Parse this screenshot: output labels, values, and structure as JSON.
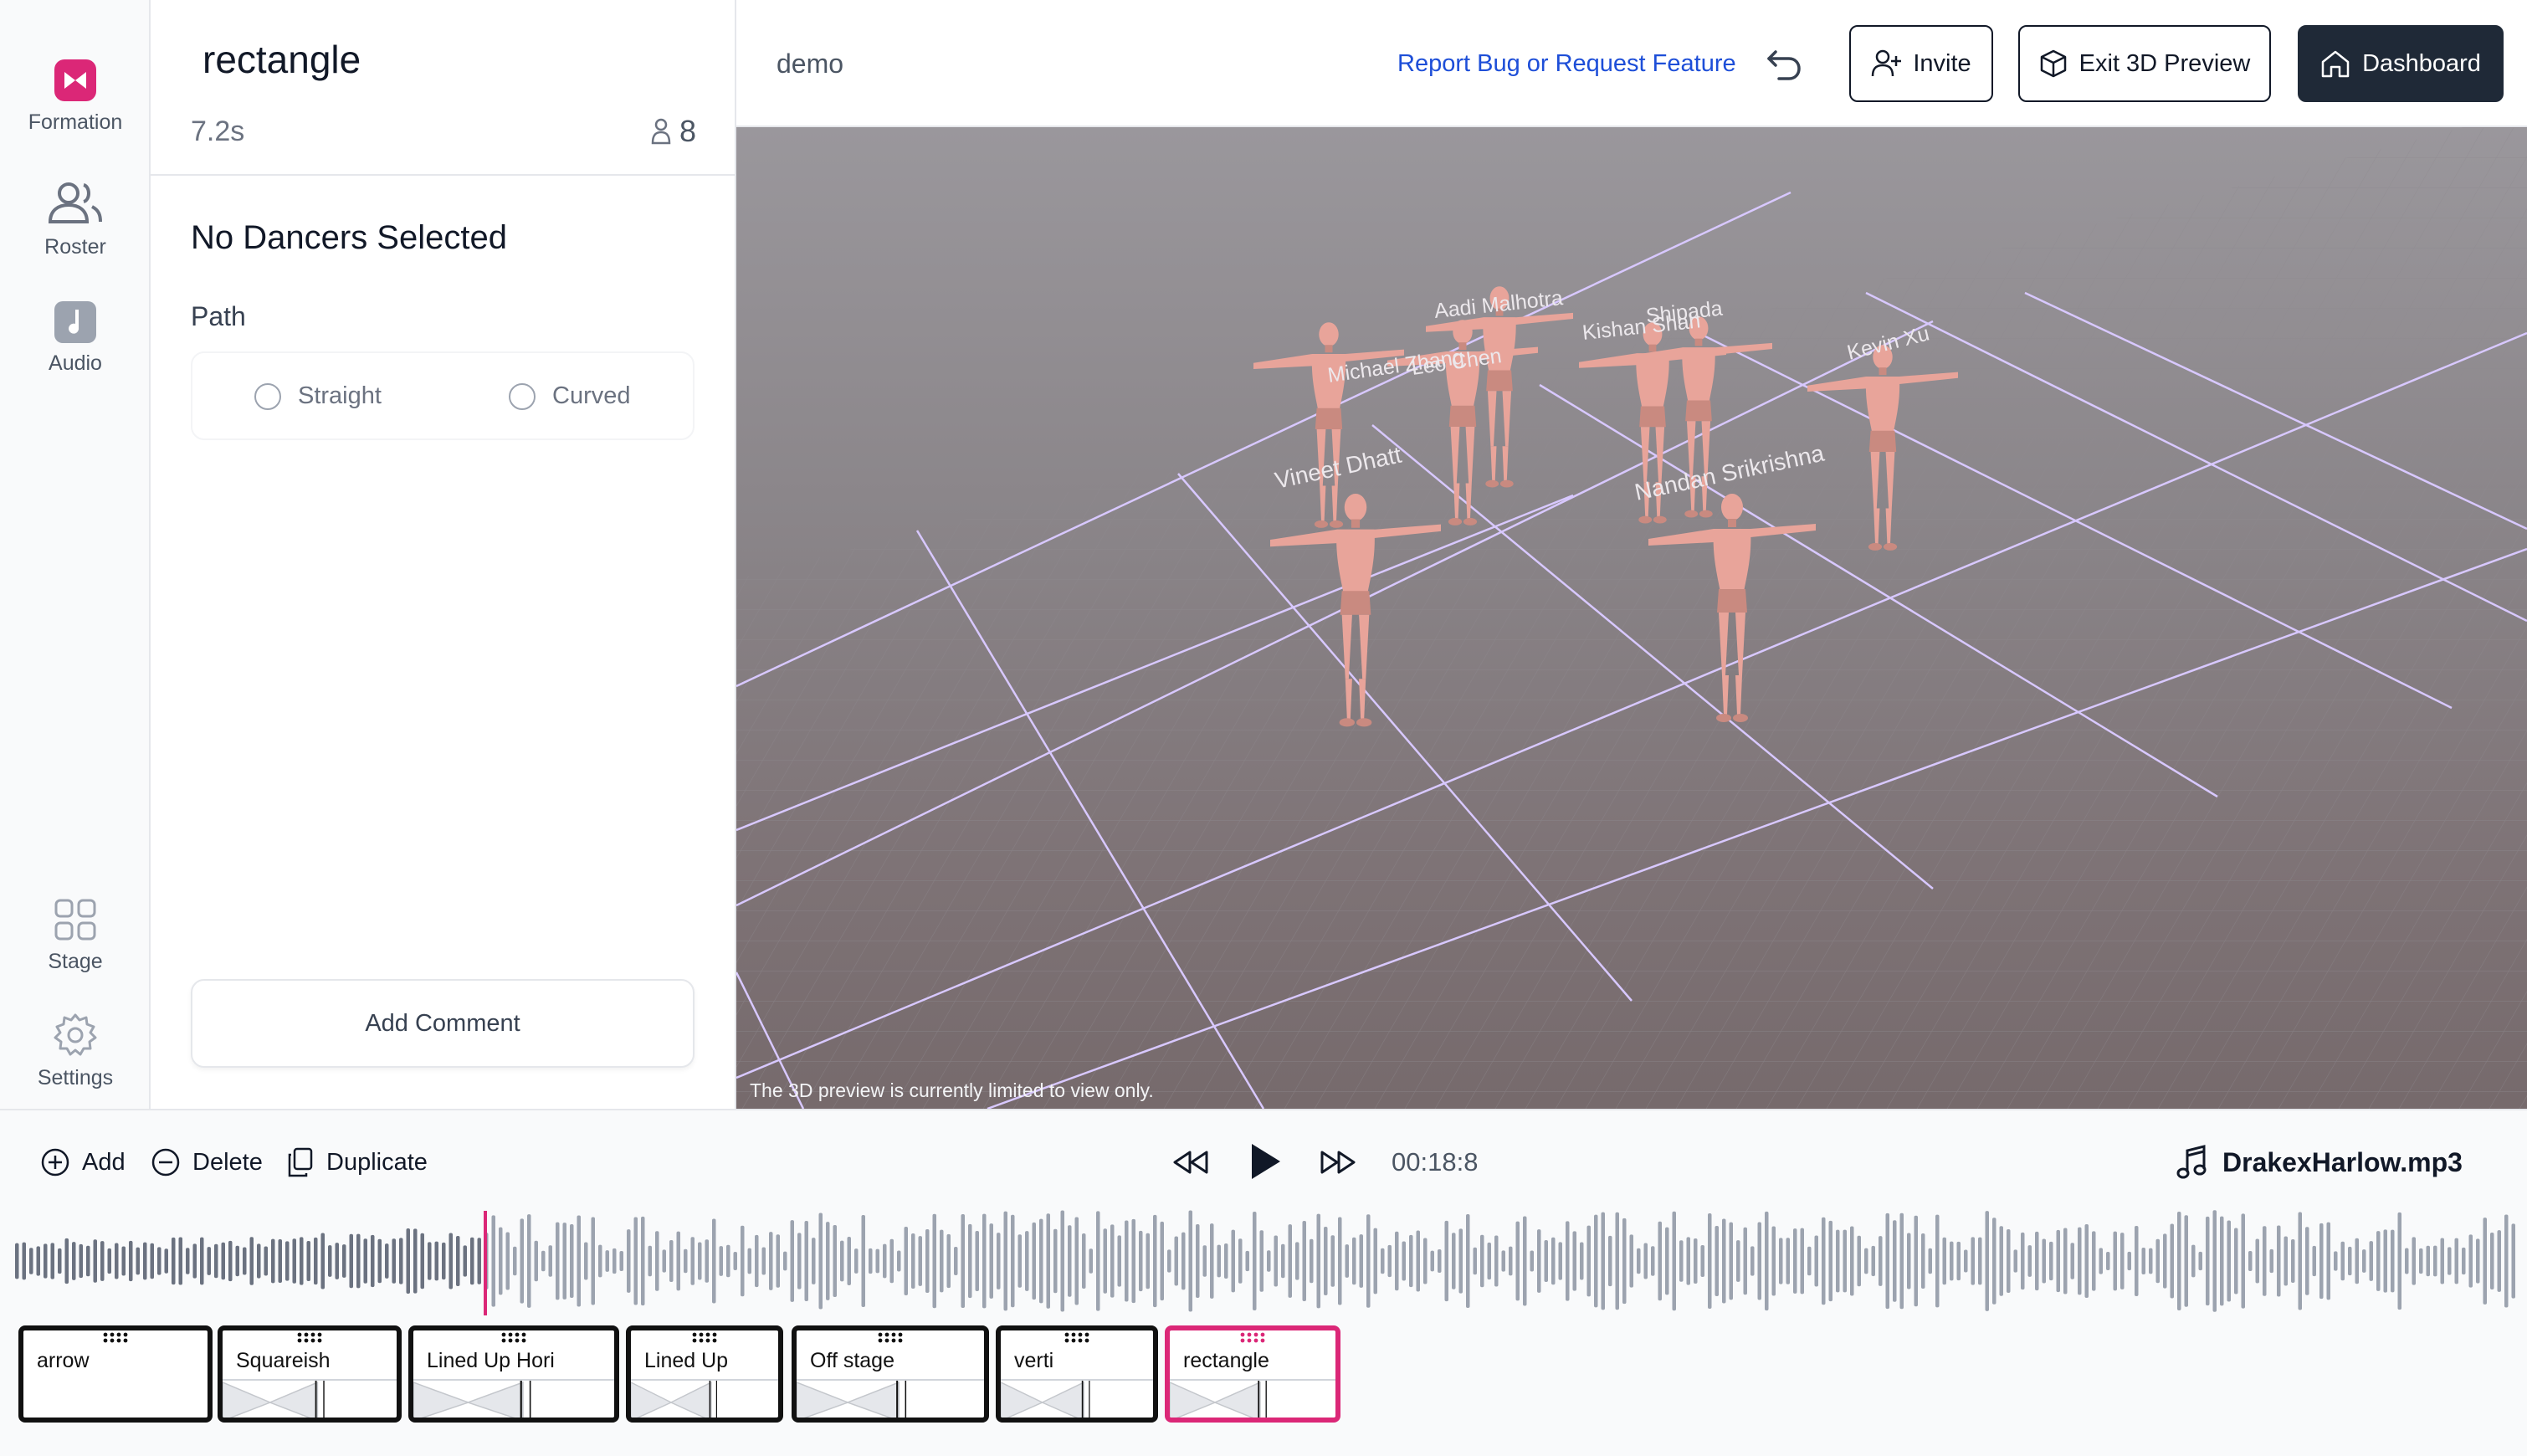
{
  "rail": {
    "formation_label": "Formation",
    "roster_label": "Roster",
    "audio_label": "Audio",
    "stage_label": "Stage",
    "settings_label": "Settings"
  },
  "panel": {
    "formation_name": "rectangle",
    "duration": "7.2s",
    "dancer_count": "8",
    "no_selection": "No Dancers Selected",
    "path_label": "Path",
    "path_options": [
      "Straight",
      "Curved"
    ],
    "add_comment": "Add Comment"
  },
  "header": {
    "project": "demo",
    "report_link": "Report Bug or Request Feature",
    "invite": "Invite",
    "exit_preview": "Exit 3D Preview",
    "dashboard": "Dashboard"
  },
  "viewport": {
    "note": "The 3D preview is currently limited to view only.",
    "dancer_names": [
      "Aadi Malhotra",
      "Michael Zhang",
      "Leo Chen",
      "Kishan Shah",
      "Shipada",
      "Kevin Xu",
      "Vineet Dhatt",
      "Nandan Srikrishna"
    ]
  },
  "toolbar": {
    "add": "Add",
    "delete": "Delete",
    "duplicate": "Duplicate",
    "time": "00:18:8",
    "track": "DrakexHarlow.mp3"
  },
  "formations": [
    "arrow",
    "Squareish",
    "Lined Up Hori",
    "Lined Up",
    "Off stage",
    "verti",
    "rectangle"
  ],
  "colors": {
    "accent": "#db2777",
    "dark": "#1f2937",
    "link": "#1d4ed8",
    "mannequin": "#e8a49a"
  }
}
